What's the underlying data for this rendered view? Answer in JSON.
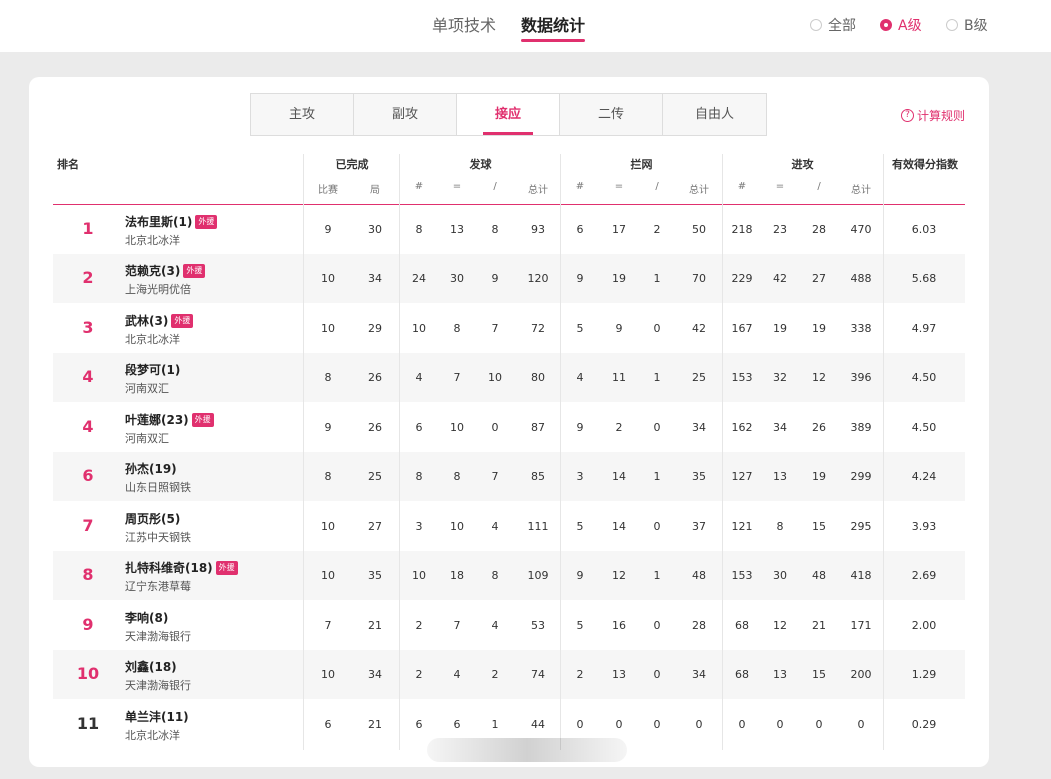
{
  "main_tabs": [
    {
      "label": "单项技术",
      "active": false
    },
    {
      "label": "数据统计",
      "active": true
    }
  ],
  "level_filter": [
    {
      "label": "全部",
      "selected": false
    },
    {
      "label": "A级",
      "selected": true
    },
    {
      "label": "B级",
      "selected": false
    }
  ],
  "sub_tabs": [
    {
      "label": "主攻",
      "active": false
    },
    {
      "label": "副攻",
      "active": false
    },
    {
      "label": "接应",
      "active": true
    },
    {
      "label": "二传",
      "active": false
    },
    {
      "label": "自由人",
      "active": false
    }
  ],
  "rules_label": "计算规则",
  "table": {
    "groups": {
      "rank": "排名",
      "completed": "已完成",
      "serve": "发球",
      "block": "拦网",
      "attack": "进攻",
      "index": "有效得分指数"
    },
    "completed_cols": [
      "比赛",
      "局"
    ],
    "stat_cols": [
      "#",
      "=",
      "/",
      "总计"
    ],
    "foreign_badge": "外援",
    "rows": [
      {
        "rank": "1",
        "name": "法布里斯(1)",
        "foreign": true,
        "team": "北京北冰洋",
        "matches": "9",
        "sets": "30",
        "serve": [
          "8",
          "13",
          "8",
          "93"
        ],
        "block": [
          "6",
          "17",
          "2",
          "50"
        ],
        "attack": [
          "218",
          "23",
          "28",
          "470"
        ],
        "index": "6.03"
      },
      {
        "rank": "2",
        "name": "范赖克(3)",
        "foreign": true,
        "team": "上海光明优倍",
        "matches": "10",
        "sets": "34",
        "serve": [
          "24",
          "30",
          "9",
          "120"
        ],
        "block": [
          "9",
          "19",
          "1",
          "70"
        ],
        "attack": [
          "229",
          "42",
          "27",
          "488"
        ],
        "index": "5.68"
      },
      {
        "rank": "3",
        "name": "武林(3)",
        "foreign": true,
        "team": "北京北冰洋",
        "matches": "10",
        "sets": "29",
        "serve": [
          "10",
          "8",
          "7",
          "72"
        ],
        "block": [
          "5",
          "9",
          "0",
          "42"
        ],
        "attack": [
          "167",
          "19",
          "19",
          "338"
        ],
        "index": "4.97"
      },
      {
        "rank": "4",
        "name": "段梦可(1)",
        "foreign": false,
        "team": "河南双汇",
        "matches": "8",
        "sets": "26",
        "serve": [
          "4",
          "7",
          "10",
          "80"
        ],
        "block": [
          "4",
          "11",
          "1",
          "25"
        ],
        "attack": [
          "153",
          "32",
          "12",
          "396"
        ],
        "index": "4.50"
      },
      {
        "rank": "4",
        "name": "叶莲娜(23)",
        "foreign": true,
        "team": "河南双汇",
        "matches": "9",
        "sets": "26",
        "serve": [
          "6",
          "10",
          "0",
          "87"
        ],
        "block": [
          "9",
          "2",
          "0",
          "34"
        ],
        "attack": [
          "162",
          "34",
          "26",
          "389"
        ],
        "index": "4.50"
      },
      {
        "rank": "6",
        "name": "孙杰(19)",
        "foreign": false,
        "team": "山东日照钢铁",
        "matches": "8",
        "sets": "25",
        "serve": [
          "8",
          "8",
          "7",
          "85"
        ],
        "block": [
          "3",
          "14",
          "1",
          "35"
        ],
        "attack": [
          "127",
          "13",
          "19",
          "299"
        ],
        "index": "4.24"
      },
      {
        "rank": "7",
        "name": "周页彤(5)",
        "foreign": false,
        "team": "江苏中天钢铁",
        "matches": "10",
        "sets": "27",
        "serve": [
          "3",
          "10",
          "4",
          "111"
        ],
        "block": [
          "5",
          "14",
          "0",
          "37"
        ],
        "attack": [
          "121",
          "8",
          "15",
          "295"
        ],
        "index": "3.93"
      },
      {
        "rank": "8",
        "name": "扎特科维奇(18)",
        "foreign": true,
        "team": "辽宁东港草莓",
        "matches": "10",
        "sets": "35",
        "serve": [
          "10",
          "18",
          "8",
          "109"
        ],
        "block": [
          "9",
          "12",
          "1",
          "48"
        ],
        "attack": [
          "153",
          "30",
          "48",
          "418"
        ],
        "index": "2.69"
      },
      {
        "rank": "9",
        "name": "李响(8)",
        "foreign": false,
        "team": "天津渤海银行",
        "matches": "7",
        "sets": "21",
        "serve": [
          "2",
          "7",
          "4",
          "53"
        ],
        "block": [
          "5",
          "16",
          "0",
          "28"
        ],
        "attack": [
          "68",
          "12",
          "21",
          "171"
        ],
        "index": "2.00"
      },
      {
        "rank": "10",
        "name": "刘鑫(18)",
        "foreign": false,
        "team": "天津渤海银行",
        "matches": "10",
        "sets": "34",
        "serve": [
          "2",
          "4",
          "2",
          "74"
        ],
        "block": [
          "2",
          "13",
          "0",
          "34"
        ],
        "attack": [
          "68",
          "13",
          "15",
          "200"
        ],
        "index": "1.29"
      },
      {
        "rank": "11",
        "name": "单兰沣(11)",
        "foreign": false,
        "team": "北京北冰洋",
        "matches": "6",
        "sets": "21",
        "serve": [
          "6",
          "6",
          "1",
          "44"
        ],
        "block": [
          "0",
          "0",
          "0",
          "0"
        ],
        "attack": [
          "0",
          "0",
          "0",
          "0"
        ],
        "index": "0.29"
      }
    ]
  }
}
